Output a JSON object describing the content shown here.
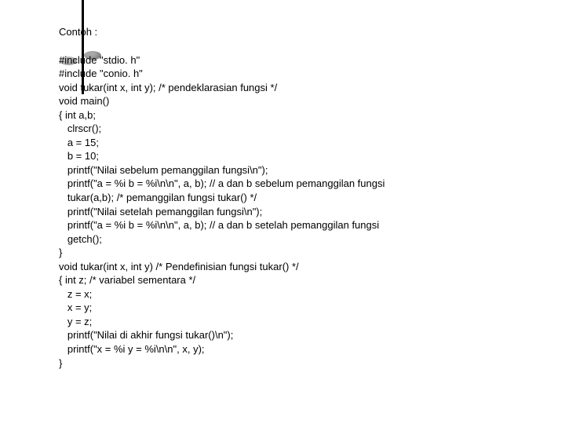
{
  "title": "Contoh :",
  "code_lines": [
    "#include \"stdio. h\"",
    "#include \"conio. h\"",
    "void tukar(int x, int y); /* pendeklarasian fungsi */",
    "void main()",
    "{ int a,b;",
    "   clrscr();",
    "   a = 15;",
    "   b = 10;",
    "   printf(\"Nilai sebelum pemanggilan fungsi\\n\");",
    "   printf(\"a = %i b = %i\\n\\n\", a, b); // a dan b sebelum pemanggilan fungsi",
    "   tukar(a,b); /* pemanggilan fungsi tukar() */",
    "   printf(\"Nilai setelah pemanggilan fungsi\\n\");",
    "   printf(\"a = %i b = %i\\n\\n\", a, b); // a dan b setelah pemanggilan fungsi",
    "   getch();",
    "}",
    "void tukar(int x, int y) /* Pendefinisian fungsi tukar() */",
    "{ int z; /* variabel sementara */",
    "   z = x;",
    "   x = y;",
    "   y = z;",
    "   printf(\"Nilai di akhir fungsi tukar()\\n\");",
    "   printf(\"x = %i y = %i\\n\\n\", x, y);",
    "}"
  ]
}
